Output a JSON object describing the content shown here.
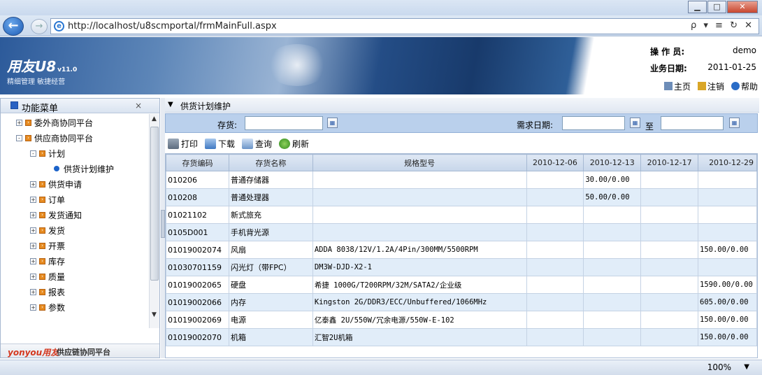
{
  "browser": {
    "url": "http://localhost/u8scmportal/frmMainFull.aspx",
    "tools": "ρ ▾ ≡ ↻ ✕",
    "zoom": "100%"
  },
  "header": {
    "logo": "用友U8",
    "version": "v11.0",
    "slogan": "精细管理 敏捷经营",
    "operator_label": "操 作 员:",
    "operator_value": "demo",
    "bizdate_label": "业务日期:",
    "bizdate_value": "2011-01-25",
    "links": [
      "主页",
      "注销",
      "帮助"
    ]
  },
  "sidebar": {
    "title": "功能菜单",
    "close": "×",
    "items": [
      {
        "label": "委外商协同平台",
        "level": 0,
        "toggle": "+"
      },
      {
        "label": "供应商协同平台",
        "level": 0,
        "toggle": "-"
      },
      {
        "label": "计划",
        "level": 1,
        "toggle": "-"
      },
      {
        "label": "供货计划维护",
        "level": 2,
        "toggle": ""
      },
      {
        "label": "供货申请",
        "level": 1,
        "toggle": "+"
      },
      {
        "label": "订单",
        "level": 1,
        "toggle": "+"
      },
      {
        "label": "发货通知",
        "level": 1,
        "toggle": "+"
      },
      {
        "label": "发货",
        "level": 1,
        "toggle": "+"
      },
      {
        "label": "开票",
        "level": 1,
        "toggle": "+"
      },
      {
        "label": "库存",
        "level": 1,
        "toggle": "+"
      },
      {
        "label": "质量",
        "level": 1,
        "toggle": "+"
      },
      {
        "label": "报表",
        "level": 1,
        "toggle": "+"
      },
      {
        "label": "参数",
        "level": 1,
        "toggle": "+"
      }
    ],
    "footer_brand": "yonyou用友",
    "footer_text": "供应链协同平台"
  },
  "main": {
    "title": "供货计划维护",
    "search": {
      "inventory_label": "存货:",
      "inventory_value": "",
      "date_label": "需求日期:",
      "date_from": "",
      "to_label": "至",
      "date_to": ""
    },
    "toolbar": [
      "打印",
      "下载",
      "查询",
      "刷新"
    ],
    "columns": [
      "存货编码",
      "存货名称",
      "规格型号",
      "2010-12-06",
      "2010-12-13",
      "2010-12-17",
      "2010-12-29"
    ],
    "rows": [
      [
        "010206",
        "普通存储器",
        "",
        "",
        "30.00/0.00",
        "",
        ""
      ],
      [
        "010208",
        "普通处理器",
        "",
        "",
        "50.00/0.00",
        "",
        ""
      ],
      [
        "01021102",
        "新式旅充",
        "",
        "",
        "",
        "",
        ""
      ],
      [
        "0105D001",
        "手机背光源",
        "",
        "",
        "",
        "",
        ""
      ],
      [
        "01019002074",
        "风扇",
        "ADDA 8038/12V/1.2A/4Pin/300MM/5500RPM",
        "",
        "",
        "",
        "150.00/0.00"
      ],
      [
        "01030701159",
        "闪光灯（带FPC）",
        "DM3W-DJD-X2-1",
        "",
        "",
        "",
        ""
      ],
      [
        "01019002065",
        "硬盘",
        "希捷 1000G/T200RPM/32M/SATA2/企业级",
        "",
        "",
        "",
        "1590.00/0.00"
      ],
      [
        "01019002066",
        "内存",
        "Kingston 2G/DDR3/ECC/Unbuffered/1066MHz",
        "",
        "",
        "",
        "605.00/0.00"
      ],
      [
        "01019002069",
        "电源",
        "亿泰鑫 2U/550W/冗余电源/550W-E-102",
        "",
        "",
        "",
        "150.00/0.00"
      ],
      [
        "01019002070",
        "机箱",
        "汇智2U机箱",
        "",
        "",
        "",
        "150.00/0.00"
      ]
    ]
  },
  "colors": {
    "accent": "#bad0ec",
    "row_alt": "#e1edf9",
    "header_dark": "#183a6b"
  }
}
